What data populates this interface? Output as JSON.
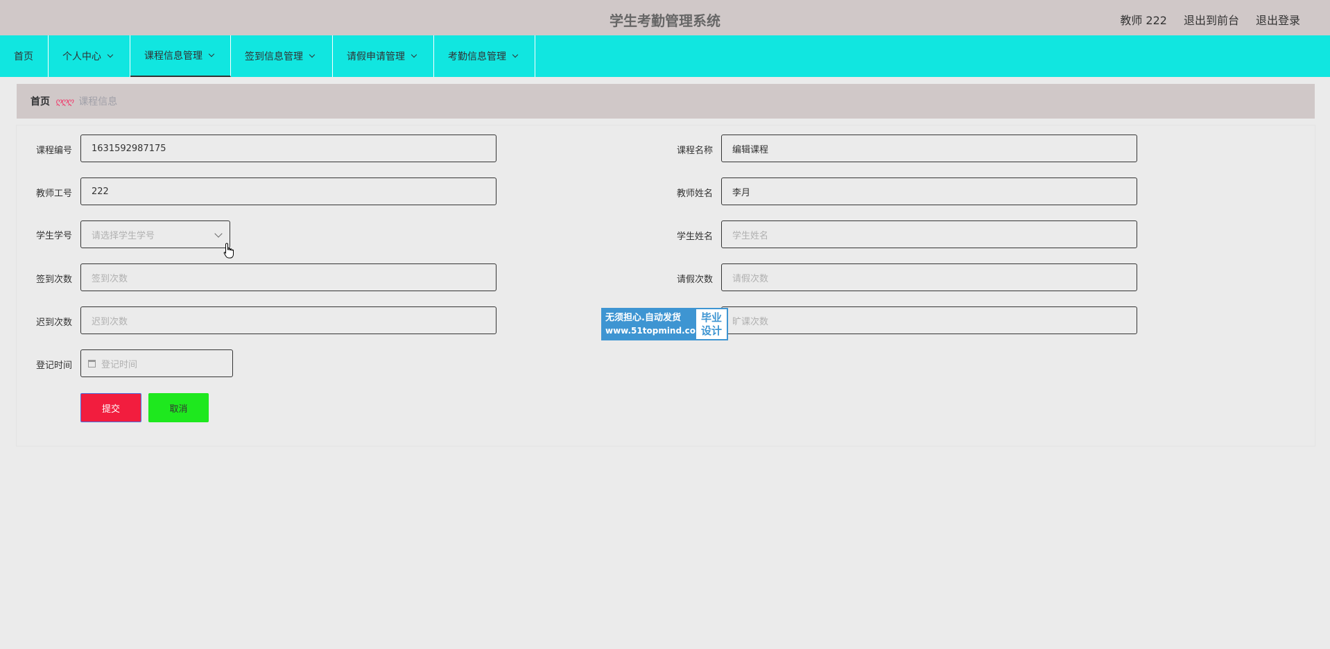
{
  "header": {
    "title": "学生考勤管理系统",
    "user": "教师 222",
    "back_to_front": "退出到前台",
    "logout": "退出登录"
  },
  "nav": {
    "items": [
      {
        "label": "首页"
      },
      {
        "label": "个人中心"
      },
      {
        "label": "课程信息管理"
      },
      {
        "label": "签到信息管理"
      },
      {
        "label": "请假申请管理"
      },
      {
        "label": "考勤信息管理"
      }
    ]
  },
  "breadcrumb": {
    "home": "首页",
    "separator": "ღღღ",
    "current": "课程信息"
  },
  "form": {
    "course_no": {
      "label": "课程编号",
      "value": "1631592987175"
    },
    "course_name": {
      "label": "课程名称",
      "value": "编辑课程"
    },
    "teacher_no": {
      "label": "教师工号",
      "value": "222"
    },
    "teacher_name": {
      "label": "教师姓名",
      "value": "李月"
    },
    "student_no": {
      "label": "学生学号",
      "placeholder": "请选择学生学号"
    },
    "student_name": {
      "label": "学生姓名",
      "placeholder": "学生姓名"
    },
    "signin_count": {
      "label": "签到次数",
      "placeholder": "签到次数"
    },
    "leave_count": {
      "label": "请假次数",
      "placeholder": "请假次数"
    },
    "late_count": {
      "label": "迟到次数",
      "placeholder": "迟到次数"
    },
    "absent_count": {
      "placeholder": "旷课次数"
    },
    "record_time": {
      "label": "登记时间",
      "placeholder": "登记时间"
    },
    "submit_label": "提交",
    "cancel_label": "取消"
  },
  "watermark": {
    "line1": "无须担心.自动发货",
    "line2": "www.51topmind.com",
    "badge1": "毕业",
    "badge2": "设计"
  },
  "colors": {
    "topbar": "#d0c8c8",
    "navbar": "#11e6e0",
    "submit": "#f21d3e",
    "cancel": "#1ee81e",
    "watermark": "#3e95d2"
  }
}
